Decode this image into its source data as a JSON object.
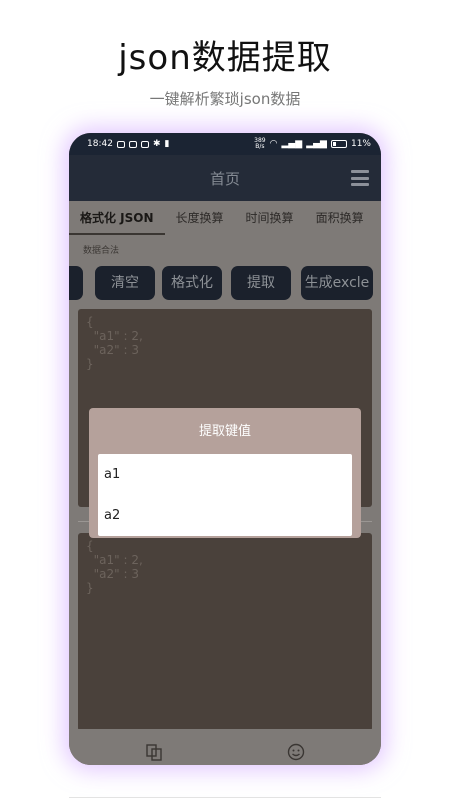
{
  "hero": {
    "title": "json数据提取",
    "subtitle": "一键解析繁琐json数据"
  },
  "statusbar": {
    "time": "18:42",
    "net_speed_top": "389",
    "net_speed_unit": "B/s",
    "battery": "11%"
  },
  "appbar": {
    "title": "首页"
  },
  "tabs": [
    {
      "label": "格式化 JSON",
      "active": true
    },
    {
      "label": "长度换算",
      "active": false
    },
    {
      "label": "时间换算",
      "active": false
    },
    {
      "label": "面积换算",
      "active": false
    }
  ],
  "valid_label": "数据合法",
  "buttons": {
    "clear": "清空",
    "format": "格式化",
    "extract": "提取",
    "generate": "生成excle"
  },
  "editor_top": {
    "content": "{\n  \"a1\" : 2,\n  \"a2\" : 3\n}"
  },
  "editor_bottom": {
    "content": "{\n  \"a1\" : 2,\n  \"a2\" : 3\n}"
  },
  "dialog": {
    "title": "提取键值",
    "items": [
      "a1",
      "a2"
    ]
  },
  "colors": {
    "appbar": "#242b38",
    "button_bg": "#1b212c",
    "overlay": "#7e7a77",
    "dialog": "#b5a19b",
    "glow": "#cda0ff"
  }
}
